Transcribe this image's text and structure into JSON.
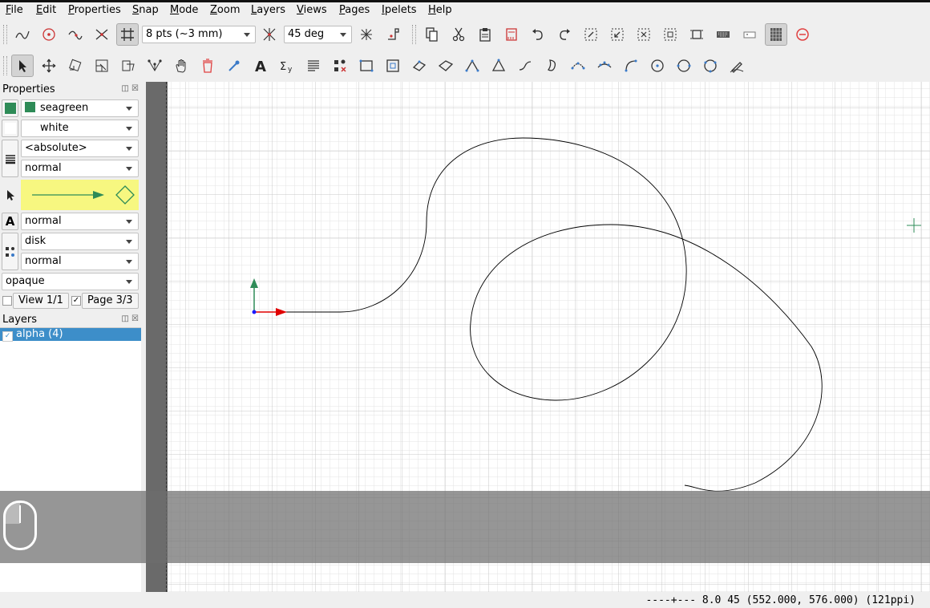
{
  "menubar": [
    {
      "label": "File",
      "key": "F",
      "rest": "ile"
    },
    {
      "label": "Edit",
      "key": "E",
      "rest": "dit"
    },
    {
      "label": "Properties",
      "key": "P",
      "rest": "roperties"
    },
    {
      "label": "Snap",
      "key": "S",
      "rest": "nap"
    },
    {
      "label": "Mode",
      "key": "M",
      "rest": "ode"
    },
    {
      "label": "Zoom",
      "key": "Z",
      "rest": "oom"
    },
    {
      "label": "Layers",
      "key": "L",
      "rest": "ayers"
    },
    {
      "label": "Views",
      "key": "V",
      "rest": "iews"
    },
    {
      "label": "Pages",
      "key": "P",
      "rest": "ages"
    },
    {
      "label": "Ipelets",
      "key": "I",
      "rest": "pelets"
    },
    {
      "label": "Help",
      "key": "H",
      "rest": "elp"
    }
  ],
  "snap": {
    "grid_size": "8 pts (~3 mm)",
    "angle": "45 deg"
  },
  "properties": {
    "title": "Properties",
    "stroke_color": "seagreen",
    "stroke_color_hex": "#2e8b57",
    "fill_color": "white",
    "fill_color_hex": "#ffffff",
    "pen_width": "<absolute>",
    "dash_style": "normal",
    "text_size": "normal",
    "mark_shape": "disk",
    "mark_size": "normal",
    "opacity": "opaque",
    "view_label": "View 1/1",
    "page_label": "Page 3/3",
    "page_checked": "✓"
  },
  "layers": {
    "title": "Layers",
    "items": [
      {
        "label": "alpha (4)",
        "checked": true
      }
    ]
  },
  "status": {
    "text": "----+--- 8.0 45 (552.000, 576.000) (121ppi)"
  },
  "colors": {
    "accent": "#3d8ec9",
    "canvas_grid": "#d8d8d8",
    "axis_x": "#e00000",
    "axis_y": "#2e8b57",
    "cursor": "#2e8b57"
  }
}
